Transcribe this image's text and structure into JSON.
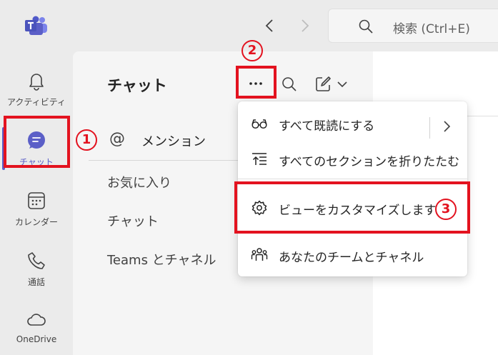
{
  "header": {
    "search_placeholder": "検索 (Ctrl+E)"
  },
  "rail": {
    "items": [
      {
        "label": "アクティビティ",
        "icon": "bell-icon"
      },
      {
        "label": "チャット",
        "icon": "chat-icon",
        "active": true
      },
      {
        "label": "カレンダー",
        "icon": "calendar-icon"
      },
      {
        "label": "通話",
        "icon": "phone-icon"
      },
      {
        "label": "OneDrive",
        "icon": "cloud-icon"
      }
    ]
  },
  "panel": {
    "title": "チャット",
    "mention_at": "@",
    "items": [
      "メンション",
      "お気に入り",
      "チャット",
      "Teams とチャネル"
    ]
  },
  "menu": {
    "items": [
      {
        "label": "すべて既読にする",
        "icon": "glasses-icon"
      },
      {
        "label": "すべてのセクションを折りたたむ",
        "icon": "collapse-icon"
      },
      {
        "label": "ビューをカスタマイズします",
        "icon": "gear-icon"
      },
      {
        "label": "あなたのチームとチャネル",
        "icon": "people-icon"
      }
    ]
  },
  "annotations": {
    "step1": "1",
    "step2": "2",
    "step3": "3"
  },
  "colors": {
    "accent": "#5b5fc7",
    "annotation": "#e3121f"
  }
}
